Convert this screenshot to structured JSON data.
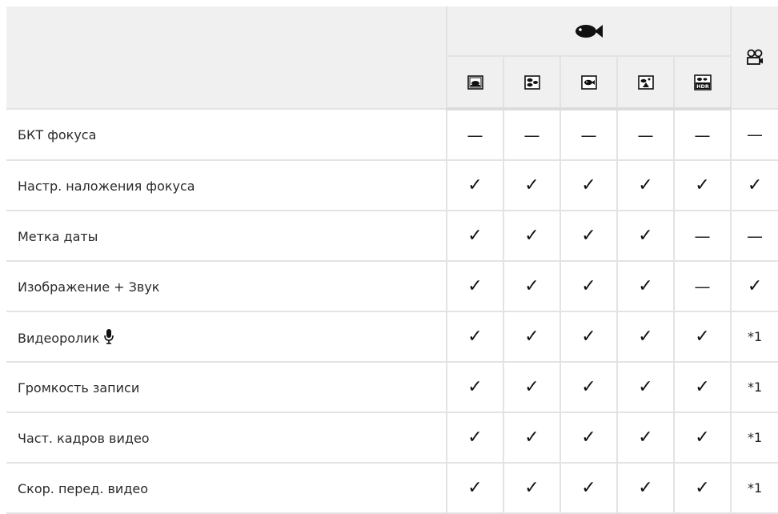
{
  "header": {
    "group_icon": "fish-icon",
    "movie_icon": "movie-camera-icon",
    "mode_icons": [
      "underwater-wide-icon",
      "underwater-macro-icon",
      "underwater-snapshot-icon",
      "underwater-microscope-icon",
      "underwater-hdr-icon"
    ],
    "hdr_text": "HDR"
  },
  "symbols": {
    "check": "✓",
    "dash": "—"
  },
  "rows": [
    {
      "label": "БКТ фокуса",
      "mic": false,
      "values": [
        "—",
        "—",
        "—",
        "—",
        "—",
        "—"
      ]
    },
    {
      "label": "Настр. наложения фокуса",
      "mic": false,
      "values": [
        "✓",
        "✓",
        "✓",
        "✓",
        "✓",
        "✓"
      ]
    },
    {
      "label": "Метка даты",
      "mic": false,
      "values": [
        "✓",
        "✓",
        "✓",
        "✓",
        "—",
        "—"
      ]
    },
    {
      "label": "Изображение + Звук",
      "mic": false,
      "values": [
        "✓",
        "✓",
        "✓",
        "✓",
        "—",
        "✓"
      ]
    },
    {
      "label": "Видеоролик",
      "mic": true,
      "values": [
        "✓",
        "✓",
        "✓",
        "✓",
        "✓",
        "*1"
      ]
    },
    {
      "label": "Громкость записи",
      "mic": false,
      "values": [
        "✓",
        "✓",
        "✓",
        "✓",
        "✓",
        "*1"
      ]
    },
    {
      "label": "Част. кадров видео",
      "mic": false,
      "values": [
        "✓",
        "✓",
        "✓",
        "✓",
        "✓",
        "*1"
      ]
    },
    {
      "label": "Скор. перед. видео",
      "mic": false,
      "values": [
        "✓",
        "✓",
        "✓",
        "✓",
        "✓",
        "*1"
      ]
    }
  ]
}
